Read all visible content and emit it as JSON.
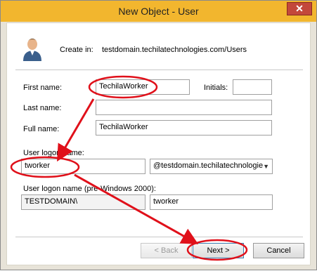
{
  "window": {
    "title": "New Object - User",
    "close_glyph": "✕"
  },
  "header": {
    "create_in_label": "Create in:",
    "create_in_path": "testdomain.techilatechnologies.com/Users",
    "icon": "user-icon"
  },
  "form": {
    "first_name_label": "First name:",
    "first_name_value": "TechilaWorker",
    "initials_label": "Initials:",
    "initials_value": "",
    "last_name_label": "Last name:",
    "last_name_value": "",
    "full_name_label": "Full name:",
    "full_name_value": "TechilaWorker",
    "logon_name_label": "User logon name:",
    "logon_name_value": "tworker",
    "domain_suffix": "@testdomain.techilatechnologie",
    "pre2000_label": "User logon name (pre-Windows 2000):",
    "pre2000_domain": "TESTDOMAIN\\",
    "pre2000_value": "tworker"
  },
  "buttons": {
    "back": "< Back",
    "next": "Next >",
    "cancel": "Cancel"
  },
  "colors": {
    "titlebar": "#f2b62e",
    "close": "#c3483b",
    "annotation": "#e0101a"
  }
}
